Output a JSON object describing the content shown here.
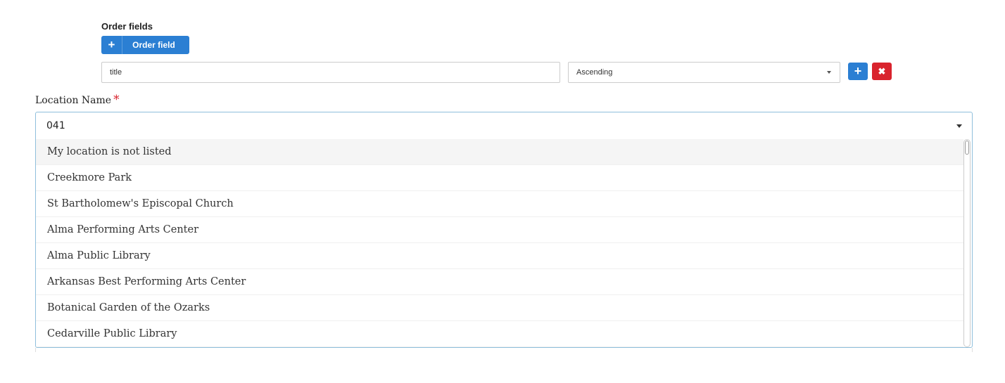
{
  "order": {
    "section_label": "Order fields",
    "add_button_icon": "plus-icon",
    "add_button_label": "Order field",
    "field_value": "title",
    "direction_value": "Ascending",
    "row_add_icon": "plus-icon",
    "row_remove_icon": "close-icon"
  },
  "location": {
    "label": "Location Name",
    "required_mark": "*",
    "input_value": "041",
    "options": [
      "My location is not listed",
      "Creekmore Park",
      "St Bartholomew's Episcopal Church",
      "Alma Performing Arts Center",
      "Alma Public Library",
      "Arkansas Best Performing Arts Center",
      "Botanical Garden of the Ozarks",
      "Cedarville Public Library"
    ]
  },
  "colors": {
    "primary": "#2b7fd3",
    "danger": "#d9232d",
    "focus_border": "#8fbfdc"
  }
}
